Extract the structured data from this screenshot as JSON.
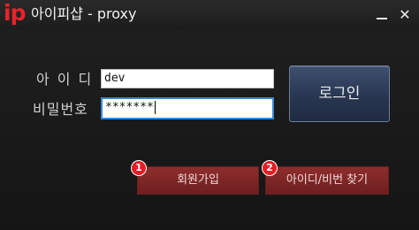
{
  "titlebar": {
    "logo": "ip",
    "title": "아이피샵 - proxy",
    "minimize_icon": "minimize-icon",
    "close_icon": "close-icon",
    "close_glyph": "✕"
  },
  "form": {
    "id_label": "아이디",
    "pw_label": "비밀번호",
    "id_value": "dev",
    "pw_value": "*******"
  },
  "buttons": {
    "login": "로그인",
    "signup": "회원가입",
    "find": "아이디/비번 찾기"
  },
  "badges": {
    "one": "1",
    "two": "2"
  },
  "colors": {
    "brand": "#e8232a",
    "login_button": "#2b3a57",
    "red_button": "#7e2626",
    "focus_border": "#3a86d8"
  }
}
